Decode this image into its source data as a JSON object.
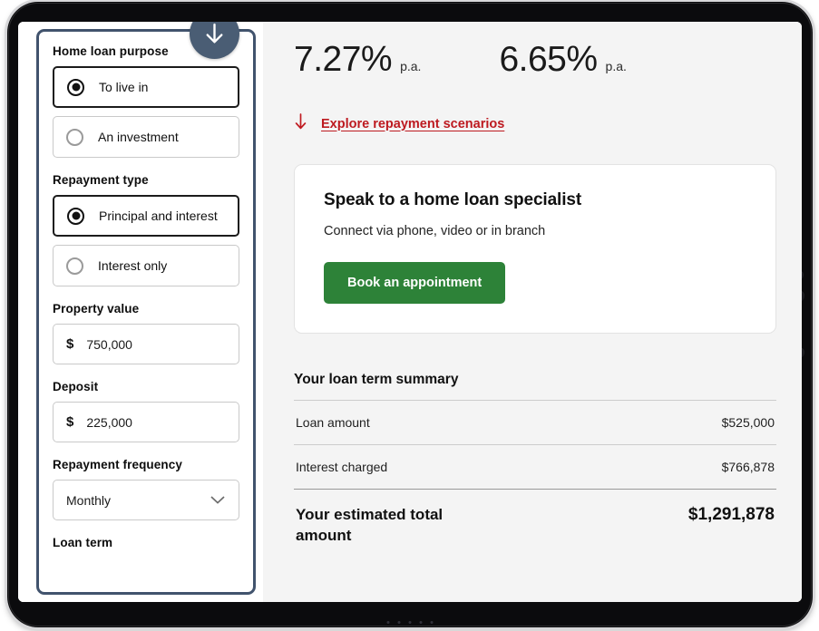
{
  "device": {
    "type": "tablet",
    "ports": [
      "port-dot",
      "port-dot",
      "indicator-dot",
      "pin-dot",
      "port-dot"
    ]
  },
  "sidebar": {
    "download_badge_icon": "download-arrow-icon",
    "groups": [
      {
        "label": "Home loan purpose",
        "type": "radio",
        "options": [
          {
            "label": "To live in",
            "selected": true
          },
          {
            "label": "An investment",
            "selected": false
          }
        ]
      },
      {
        "label": "Repayment type",
        "type": "radio",
        "options": [
          {
            "label": "Principal and interest",
            "selected": true
          },
          {
            "label": "Interest only",
            "selected": false
          }
        ]
      },
      {
        "label": "Property value",
        "type": "currency",
        "currency_symbol": "$",
        "value": "750,000"
      },
      {
        "label": "Deposit",
        "type": "currency",
        "currency_symbol": "$",
        "value": "225,000"
      },
      {
        "label": "Repayment frequency",
        "type": "select",
        "value": "Monthly",
        "chevron_icon": "chevron-down-icon"
      },
      {
        "label": "Loan term",
        "type": "cutoff"
      }
    ]
  },
  "main": {
    "rates": [
      {
        "value": "7.27%",
        "unit": "p.a."
      },
      {
        "value": "6.65%",
        "unit": "p.a."
      }
    ],
    "explore_link": {
      "icon": "arrow-down-icon",
      "label": "Explore repayment scenarios",
      "color": "#bd1a20"
    },
    "specialist_card": {
      "title": "Speak to a home loan specialist",
      "subtitle": "Connect via phone, video or in branch",
      "button_label": "Book an appointment",
      "button_color": "#2d8238"
    },
    "summary": {
      "title": "Your loan term summary",
      "rows": [
        {
          "label": "Loan amount",
          "value": "$525,000"
        },
        {
          "label": "Interest charged",
          "value": "$766,878"
        }
      ],
      "total": {
        "label": "Your estimated total amount",
        "value": "$1,291,878"
      }
    }
  },
  "colors": {
    "panel_border": "#41536d",
    "badge": "#4a5d74",
    "accent_red": "#bd1a20",
    "accent_green": "#2d8238",
    "main_bg": "#f4f4f4"
  }
}
